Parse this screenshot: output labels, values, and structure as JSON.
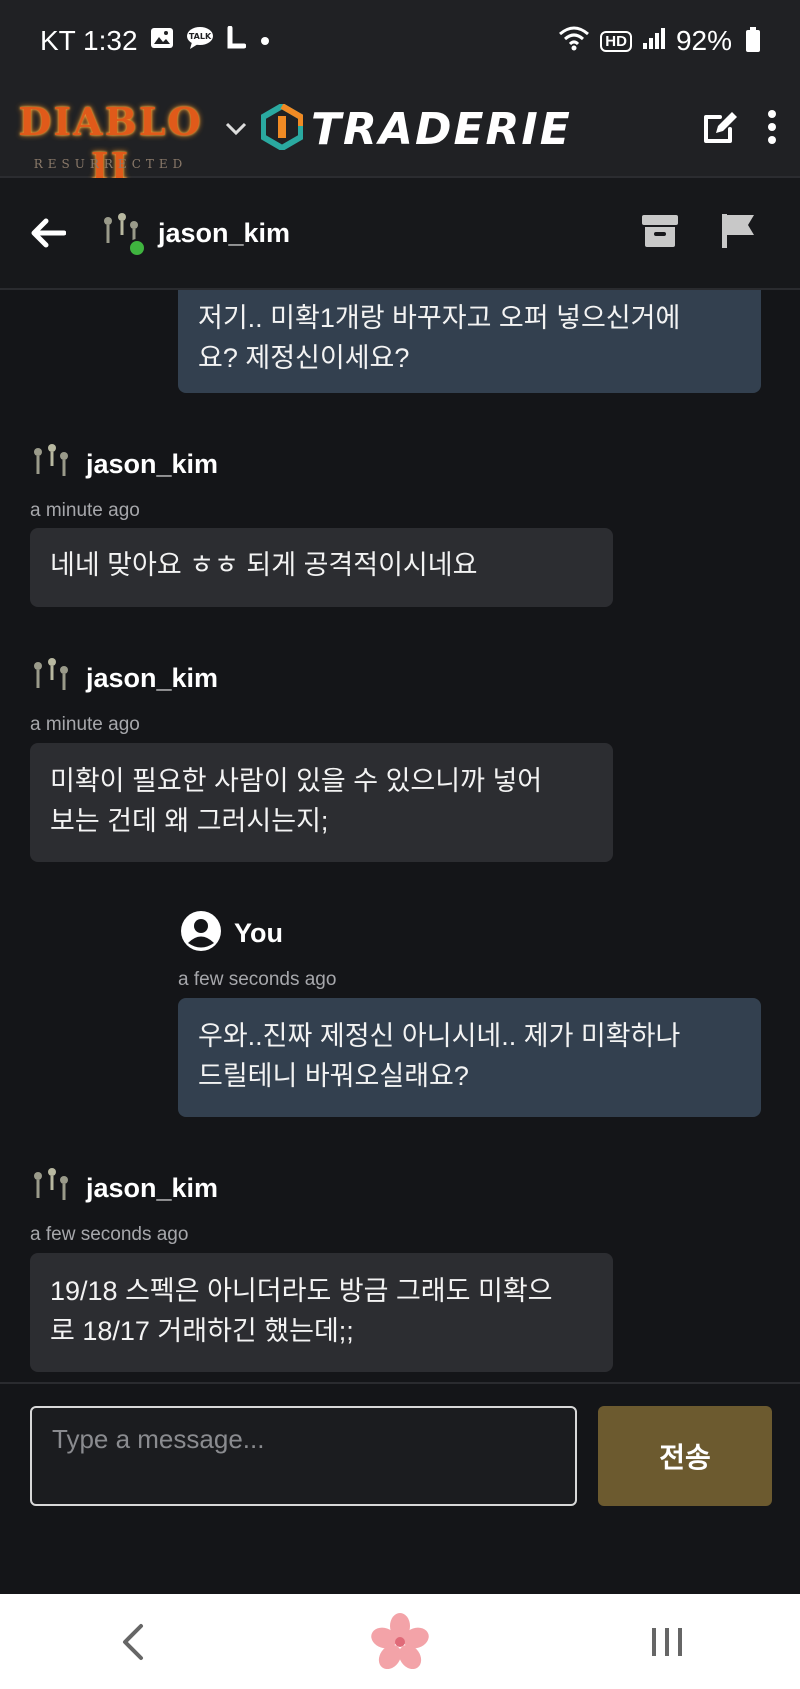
{
  "status_bar": {
    "carrier_time": "KT 1:32",
    "notif_icons": [
      "image-icon",
      "talk-icon",
      "l-icon",
      "dot-icon"
    ],
    "hd_label": "HD",
    "battery": "92%"
  },
  "app_bar": {
    "game_logo_text": "DIABLO II",
    "game_logo_sub": "RESURRECTED",
    "brand": "TRADERIE",
    "icons": [
      "dropdown-chevron-icon",
      "compose-icon",
      "more-vert-icon"
    ]
  },
  "chat_header": {
    "username": "jason_kim",
    "online": true,
    "icons": [
      "back-arrow-icon",
      "archive-icon",
      "flag-icon"
    ]
  },
  "messages": [
    {
      "from": "me",
      "text_lines": [
        "저기.. 미확1개랑 바꾸자고 오퍼 넣으신거에",
        "요? 제정신이세요?"
      ]
    },
    {
      "from": "them",
      "sender": "jason_kim",
      "time": "a minute ago",
      "text_lines": [
        "네네 맞아요 ㅎㅎ 되게 공격적이시네요"
      ]
    },
    {
      "from": "them",
      "sender": "jason_kim",
      "time": "a minute ago",
      "text_lines": [
        "미확이 필요한 사람이 있을 수 있으니까 넣어",
        "보는 건데 왜 그러시는지;"
      ]
    },
    {
      "from": "me",
      "sender": "You",
      "time": "a few seconds ago",
      "text_lines": [
        "우와..진짜 제정신 아니시네.. 제가 미확하나",
        "드릴테니 바꿔오실래요?"
      ]
    },
    {
      "from": "them",
      "sender": "jason_kim",
      "time": "a few seconds ago",
      "text_lines": [
        "19/18 스펙은 아니더라도 방금 그래도 미확으",
        "로 18/17 거래하긴 했는데;;"
      ]
    }
  ],
  "composer": {
    "placeholder": "Type a message...",
    "send_label": "전송"
  },
  "nav_bar": {
    "icons": [
      "nav-back-icon",
      "home-flower-icon",
      "recents-icon"
    ]
  },
  "colors": {
    "my_bubble": "#33404f",
    "their_bubble": "#2c2d31",
    "send_button": "#6c5a2f",
    "online": "#3fb43f",
    "background": "#141518"
  }
}
